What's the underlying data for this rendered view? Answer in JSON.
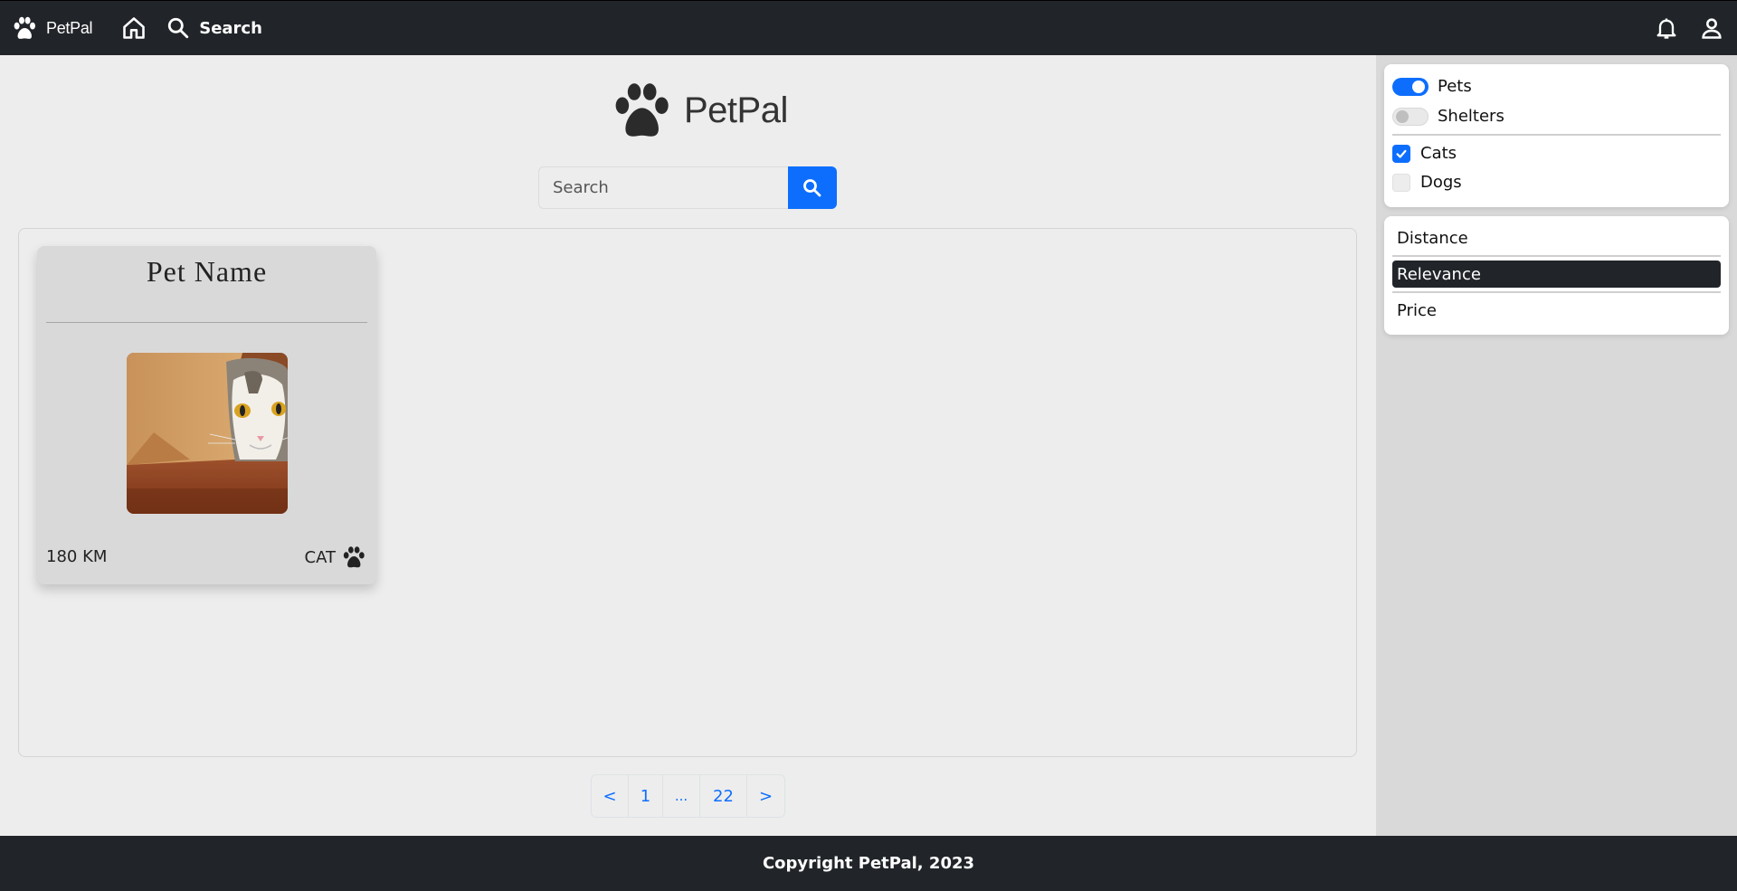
{
  "navbar": {
    "brand": "PetPal",
    "search_label": "Search"
  },
  "main": {
    "logo_text": "PetPal",
    "search": {
      "placeholder": "Search",
      "value": ""
    },
    "pet_card": {
      "name": "Pet Name",
      "distance": "180 KM",
      "type": "CAT"
    },
    "pagination": [
      "<",
      "1",
      "...",
      "22",
      ">"
    ]
  },
  "sidebar": {
    "toggles": [
      {
        "label": "Pets",
        "on": true
      },
      {
        "label": "Shelters",
        "on": false
      }
    ],
    "checks": [
      {
        "label": "Cats",
        "checked": true
      },
      {
        "label": "Dogs",
        "checked": false
      }
    ],
    "sort": [
      {
        "label": "Distance",
        "active": false
      },
      {
        "label": "Relevance",
        "active": true
      },
      {
        "label": "Price",
        "active": false
      }
    ]
  },
  "footer": {
    "text": "Copyright PetPal, 2023"
  },
  "colors": {
    "nav_bg": "#212529",
    "accent": "#0d6efd",
    "page_bg": "#ededed",
    "sidebar_bg": "#d9d9d9"
  },
  "icons": [
    "paw-icon",
    "home-icon",
    "search-icon",
    "bell-icon",
    "user-icon",
    "checkmark-icon"
  ]
}
